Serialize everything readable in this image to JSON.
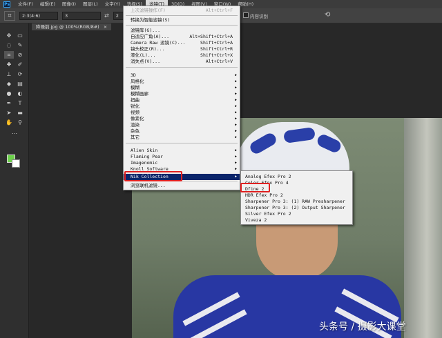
{
  "app": {
    "logo": "Ps",
    "menus": [
      "文件(F)",
      "编辑(E)",
      "图像(I)",
      "图层(L)",
      "文字(Y)",
      "选择(S)",
      "滤镜(T)",
      "3D(D)",
      "视图(V)",
      "窗口(W)",
      "帮助(H)"
    ],
    "active_menu_index": 6
  },
  "options_bar": {
    "tool_icon": "crop-icon",
    "ratio_value": "2:3(4:6)",
    "width_value": "3",
    "swap_symbol": "⇄",
    "height_value": "2",
    "content_aware_label": "内容识别",
    "rotate_icon": "undo-icon"
  },
  "document_tab": {
    "title": "降噪前.jpg @ 100%(RGB/8#)",
    "close_symbol": "×"
  },
  "filter_menu": {
    "items": [
      {
        "label": "上次滤镜操作(F)",
        "shortcut": "Alt+Ctrl+F",
        "disabled": true
      },
      {
        "label": "转换为智能滤镜(S)",
        "shortcut": ""
      },
      {
        "label": "滤镜库(G)...",
        "shortcut": ""
      },
      {
        "label": "自适应广角(A)...",
        "shortcut": "Alt+Shift+Ctrl+A"
      },
      {
        "label": "Camera Raw 滤镜(C)...",
        "shortcut": "Shift+Ctrl+A"
      },
      {
        "label": "镜头校正(R)...",
        "shortcut": "Shift+Ctrl+R"
      },
      {
        "label": "液化(L)...",
        "shortcut": "Shift+Ctrl+X"
      },
      {
        "label": "消失点(V)...",
        "shortcut": "Alt+Ctrl+V"
      },
      {
        "label": "3D",
        "submenu": true
      },
      {
        "label": "风格化",
        "submenu": true
      },
      {
        "label": "模糊",
        "submenu": true
      },
      {
        "label": "模糊画廊",
        "submenu": true
      },
      {
        "label": "扭曲",
        "submenu": true
      },
      {
        "label": "锐化",
        "submenu": true
      },
      {
        "label": "视频",
        "submenu": true
      },
      {
        "label": "像素化",
        "submenu": true
      },
      {
        "label": "渲染",
        "submenu": true
      },
      {
        "label": "杂色",
        "submenu": true
      },
      {
        "label": "其它",
        "submenu": true
      },
      {
        "label": "Alien Skin",
        "submenu": true
      },
      {
        "label": "Flaming Pear",
        "submenu": true
      },
      {
        "label": "Imagenomic",
        "submenu": true
      },
      {
        "label": "Knoll Software",
        "submenu": true
      },
      {
        "label": "Nik Collection",
        "submenu": true,
        "highlighted": true
      },
      {
        "label": "浏览联机滤镜...",
        "shortcut": ""
      }
    ],
    "submenu_arrow": "▶"
  },
  "nik_submenu": {
    "items": [
      "Analog Efex Pro 2",
      "Color Efex Pro 4",
      "Dfine 2",
      "HDR Efex Pro 2",
      "Sharpener Pro 3: (1) RAW Presharpener",
      "Sharpener Pro 3: (2) Output Sharpener",
      "Silver Efex Pro 2",
      "Viveza 2"
    ],
    "emphasized_index": 2
  },
  "tools": [
    "move-icon",
    "marquee-icon",
    "lasso-icon",
    "quick-select-icon",
    "crop-icon",
    "eyedropper-icon",
    "healing-icon",
    "brush-icon",
    "stamp-icon",
    "history-brush-icon",
    "eraser-icon",
    "gradient-icon",
    "blur-icon",
    "dodge-icon",
    "pen-icon",
    "type-icon",
    "path-select-icon",
    "shape-icon",
    "hand-icon",
    "zoom-icon",
    "more-icon"
  ],
  "colors": {
    "foreground": "#6cd14a",
    "background": "#ffffff",
    "highlight": "#0a246a",
    "annotation": "#e02020"
  },
  "watermark": "头条号 / 摄影大课堂"
}
